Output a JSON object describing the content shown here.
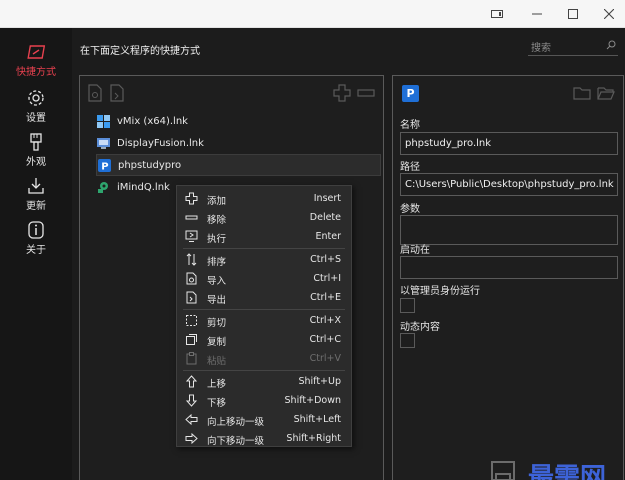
{
  "window": {
    "controls": {
      "icon": "tablet-icon",
      "minimize": "—",
      "maximize": "☐",
      "close": "✕"
    }
  },
  "nav": {
    "items": [
      {
        "label": "快捷方式",
        "icon": "shortcut-icon",
        "active": true
      },
      {
        "label": "设置",
        "icon": "gear-icon",
        "active": false
      },
      {
        "label": "外观",
        "icon": "brush-icon",
        "active": false
      },
      {
        "label": "更新",
        "icon": "download-icon",
        "active": false
      },
      {
        "label": "关于",
        "icon": "info-icon",
        "active": false
      }
    ]
  },
  "header": {
    "title": "在下面定义程序的快捷方式",
    "search_placeholder": "搜索"
  },
  "shortcuts": {
    "items": [
      {
        "name": "vMix (x64).lnk",
        "icon": "vmix-icon"
      },
      {
        "name": "DisplayFusion.lnk",
        "icon": "displayfusion-icon"
      },
      {
        "name": "phpstudy_pro.lnk",
        "display": "phpstudypro",
        "icon": "phpstudy-icon",
        "selected": true
      },
      {
        "name": "iMindQ.lnk",
        "icon": "imindq-icon"
      }
    ]
  },
  "details": {
    "app_icon_letter": "P",
    "name_label": "名称",
    "name_value": "phpstudy_pro.lnk",
    "path_label": "路径",
    "path_value": "C:\\Users\\Public\\Desktop\\phpstudy_pro.lnk",
    "args_label": "参数",
    "args_value": "",
    "startin_label": "启动在",
    "startin_value": "",
    "admin_label": "以管理员身份运行",
    "dynamic_label": "动态内容"
  },
  "context_menu": {
    "items": [
      {
        "label": "添加",
        "shortcut": "Insert",
        "icon": "plus-icon",
        "disabled": false
      },
      {
        "label": "移除",
        "shortcut": "Delete",
        "icon": "minus-icon",
        "disabled": false
      },
      {
        "label": "执行",
        "shortcut": "Enter",
        "icon": "run-icon",
        "disabled": false
      },
      {
        "label": "排序",
        "shortcut": "Ctrl+S",
        "icon": "sort-icon",
        "disabled": false
      },
      {
        "label": "导入",
        "shortcut": "Ctrl+I",
        "icon": "import-icon",
        "disabled": false
      },
      {
        "label": "导出",
        "shortcut": "Ctrl+E",
        "icon": "export-icon",
        "disabled": false
      },
      {
        "label": "剪切",
        "shortcut": "Ctrl+X",
        "icon": "cut-icon",
        "disabled": false
      },
      {
        "label": "复制",
        "shortcut": "Ctrl+C",
        "icon": "copy-icon",
        "disabled": false
      },
      {
        "label": "粘贴",
        "shortcut": "Ctrl+V",
        "icon": "paste-icon",
        "disabled": true
      },
      {
        "label": "上移",
        "shortcut": "Shift+Up",
        "icon": "arrow-up-icon",
        "disabled": false
      },
      {
        "label": "下移",
        "shortcut": "Shift+Down",
        "icon": "arrow-down-icon",
        "disabled": false
      },
      {
        "label": "向上移动一级",
        "shortcut": "Shift+Left",
        "icon": "level-up-icon",
        "disabled": false
      },
      {
        "label": "向下移动一级",
        "shortcut": "Shift+Right",
        "icon": "level-down-icon",
        "disabled": false
      }
    ]
  },
  "watermark": {
    "text": "最需网"
  },
  "colors": {
    "accent": "#e8414f",
    "background": "#1c1c1c",
    "panel_border": "#5a5a5a",
    "watermark": "#3d63d8"
  }
}
